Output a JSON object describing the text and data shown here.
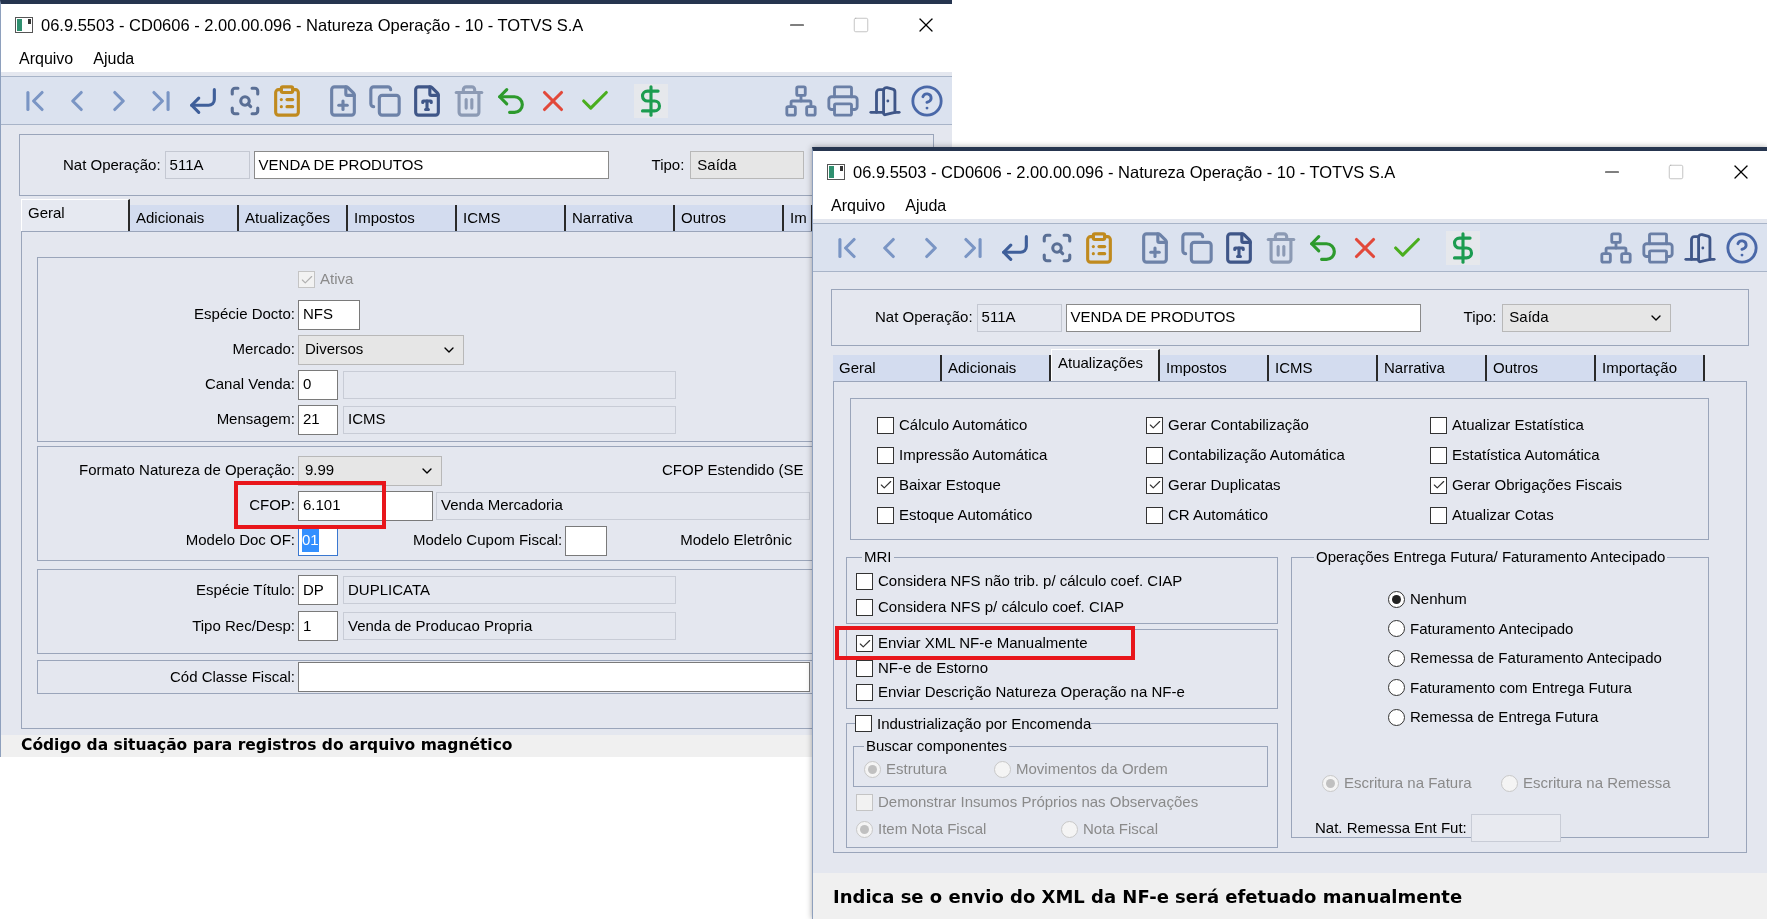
{
  "back_window": {
    "title": "06.9.5503 - CD0606 - 2.00.00.096 - Natureza Operação - 10 - TOTVS S.A",
    "menu": [
      "Arquivo",
      "Ajuda"
    ],
    "header": {
      "nat_label": "Nat Operação:",
      "nat_code": "511A",
      "nat_description": "VENDA DE PRODUTOS",
      "tipo_label": "Tipo:",
      "tipo_value": "Saída"
    },
    "tabs": [
      {
        "label": "Geral",
        "selected": true
      },
      {
        "label": "Adicionais",
        "selected": false
      },
      {
        "label": "Atualizações",
        "selected": false
      },
      {
        "label": "Impostos",
        "selected": false
      },
      {
        "label": "ICMS",
        "selected": false
      },
      {
        "label": "Narrativa",
        "selected": false
      },
      {
        "label": "Outros",
        "selected": false
      },
      {
        "label": "Im",
        "selected": false
      }
    ],
    "geral": {
      "ativa": {
        "label": "Ativa",
        "checked": true,
        "disabled": true
      },
      "especie_docto": {
        "label": "Espécie Docto:",
        "value": "NFS"
      },
      "mercado": {
        "label": "Mercado:",
        "value": "Diversos"
      },
      "canal_venda": {
        "label": "Canal Venda:",
        "value": "0"
      },
      "mensagem": {
        "label": "Mensagem:",
        "value": "21",
        "description": "ICMS"
      },
      "formato": {
        "label": "Formato Natureza de Operação:",
        "value": "9.99"
      },
      "cfop_estendido": {
        "label": "CFOP Estendido (SE"
      },
      "cfop": {
        "label": "CFOP:",
        "value": "6.101",
        "description": "Venda Mercadoria",
        "annotated": true
      },
      "modelo_doc_of": {
        "label": "Modelo Doc OF:",
        "value": "01",
        "text_selected": true
      },
      "modelo_cupom_fiscal": {
        "label": "Modelo Cupom Fiscal:"
      },
      "modelo_eletronico": {
        "label": "Modelo Eletrônic"
      },
      "especie_titulo": {
        "label": "Espécie Título:",
        "value": "DP",
        "description": "DUPLICATA"
      },
      "tipo_rec_desp": {
        "label": "Tipo Rec/Desp:",
        "value": "1",
        "description": "Venda de Producao Propria"
      },
      "cod_classe_fiscal": {
        "label": "Cód Classe Fiscal:"
      }
    },
    "status_bar": "Código da situação para registros do arquivo magnético"
  },
  "front_window": {
    "title": "06.9.5503 - CD0606 - 2.00.00.096 - Natureza Operação - 10 - TOTVS S.A",
    "menu": [
      "Arquivo",
      "Ajuda"
    ],
    "header": {
      "nat_label": "Nat Operação:",
      "nat_code": "511A",
      "nat_description": "VENDA DE PRODUTOS",
      "tipo_label": "Tipo:",
      "tipo_value": "Saída"
    },
    "tabs": [
      {
        "label": "Geral",
        "selected": false
      },
      {
        "label": "Adicionais",
        "selected": false
      },
      {
        "label": "Atualizações",
        "selected": true
      },
      {
        "label": "Impostos",
        "selected": false
      },
      {
        "label": "ICMS",
        "selected": false
      },
      {
        "label": "Narrativa",
        "selected": false
      },
      {
        "label": "Outros",
        "selected": false
      },
      {
        "label": "Importação",
        "selected": false
      }
    ],
    "atualizacoes": {
      "option_columns": [
        [
          {
            "label": "Cálculo Automático",
            "checked": false
          },
          {
            "label": "Impressão Automática",
            "checked": false
          },
          {
            "label": "Baixar Estoque",
            "checked": true
          },
          {
            "label": "Estoque Automático",
            "checked": false
          }
        ],
        [
          {
            "label": "Gerar Contabilização",
            "checked": true
          },
          {
            "label": "Contabilização Automática",
            "checked": false
          },
          {
            "label": "Gerar Duplicatas",
            "checked": true
          },
          {
            "label": "CR Automático",
            "checked": false
          }
        ],
        [
          {
            "label": "Atualizar Estatística",
            "checked": false
          },
          {
            "label": "Estatística Automática",
            "checked": false
          },
          {
            "label": "Gerar Obrigações Fiscais",
            "checked": true
          },
          {
            "label": "Atualizar Cotas",
            "checked": false
          }
        ]
      ],
      "mri": {
        "title": "MRI",
        "items": [
          {
            "label": "Considera NFS não trib. p/ cálculo coef. CIAP",
            "checked": false
          },
          {
            "label": "Considera NFS p/ cálculo coef. CIAP",
            "checked": false
          }
        ]
      },
      "nfe_items": [
        {
          "label": "Enviar XML NF-e Manualmente",
          "checked": true,
          "annotated": true
        },
        {
          "label": "NF-e de Estorno",
          "checked": false,
          "annotated": false
        },
        {
          "label": "Enviar Descrição Natureza Operação na NF-e",
          "checked": false,
          "annotated": false
        }
      ],
      "industrializacao": {
        "label": "Industrialização por Encomenda",
        "checked": false,
        "buscar_title": "Buscar componentes",
        "buscar_options": [
          {
            "label": "Estrutura",
            "selected": true,
            "disabled": true
          },
          {
            "label": "Movimentos da Ordem",
            "selected": false,
            "disabled": true
          }
        ],
        "demonstrar": {
          "label": "Demonstrar Insumos Próprios nas Observações",
          "checked": false,
          "disabled": true
        },
        "nota_options": [
          {
            "label": "Item Nota Fiscal",
            "selected": true,
            "disabled": true
          },
          {
            "label": "Nota Fiscal",
            "selected": false,
            "disabled": true
          }
        ]
      },
      "operacoes": {
        "title": "Operações Entrega Futura/ Faturamento Antecipado",
        "options": [
          {
            "label": "Nenhum",
            "selected": true,
            "disabled": false
          },
          {
            "label": "Faturamento Antecipado",
            "selected": false,
            "disabled": false
          },
          {
            "label": "Remessa de Faturamento Antecipado",
            "selected": false,
            "disabled": false
          },
          {
            "label": "Faturamento com Entrega Futura",
            "selected": false,
            "disabled": false
          },
          {
            "label": "Remessa de Entrega Futura",
            "selected": false,
            "disabled": false
          }
        ],
        "escritura_options": [
          {
            "label": "Escritura na Fatura",
            "selected": true,
            "disabled": true
          },
          {
            "label": "Escritura na Remessa",
            "selected": false,
            "disabled": true
          }
        ],
        "nat_remessa_label": "Nat. Remessa Ent Fut:"
      }
    },
    "status_bar": "Indica se o envio do XML da NF-e será efetuado manualmente"
  }
}
